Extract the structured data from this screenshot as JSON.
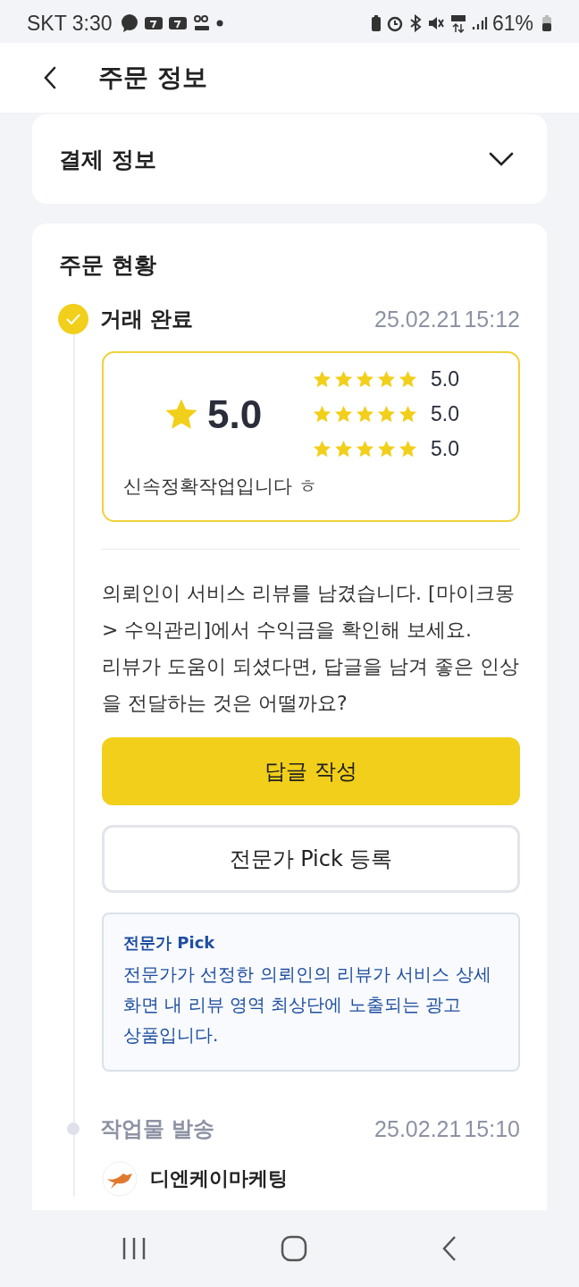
{
  "status_bar": {
    "carrier": "SKT",
    "time": "3:30",
    "battery": "61%"
  },
  "header": {
    "title": "주문 정보"
  },
  "payment_section": {
    "title": "결제 정보",
    "expanded": false
  },
  "order_status": {
    "title": "주문 현황",
    "steps": [
      {
        "label": "거래 완료",
        "date": "25.02.21",
        "time": "15:12",
        "active": true
      },
      {
        "label": "작업물 발송",
        "date": "25.02.21",
        "time": "15:10",
        "active": false
      }
    ]
  },
  "review": {
    "overall": "5.0",
    "ratings": [
      {
        "stars": 5,
        "score": "5.0"
      },
      {
        "stars": 5,
        "score": "5.0"
      },
      {
        "stars": 5,
        "score": "5.0"
      }
    ],
    "comment": "신속정확작업입니다 ㅎ"
  },
  "message": "의뢰인이 서비스 리뷰를 남겼습니다. [마이크몽> 수익관리]에서 수익금을 확인해 보세요.\n 리뷰가 도움이 되셨다면, 답글을 남겨 좋은 인상을 전달하는 것은 어떨까요?",
  "buttons": [
    {
      "label": "답글 작성",
      "kind": "primary"
    },
    {
      "label": "전문가 Pick 등록",
      "kind": "outline"
    }
  ],
  "info_box": {
    "title": "전문가 Pick",
    "text": "전문가가 선정한 의뢰인의 리뷰가 서비스 상세 화면 내 리뷰 영역 최상단에 노출되는 광고 상품입니다."
  },
  "seller": {
    "name": "디엔케이마케팅"
  }
}
